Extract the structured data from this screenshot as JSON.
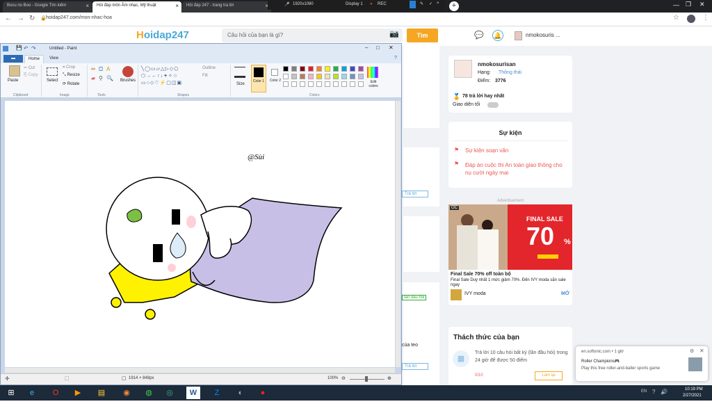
{
  "browser": {
    "tabs": [
      {
        "label": "Bocu no Boo - Google Tìm kiếm",
        "active": false
      },
      {
        "label": "Hỏi đáp môn Âm nhạc, Mỹ thuật",
        "active": true
      },
      {
        "label": "Hỏi đáp 247 - trang tra lời",
        "active": false
      }
    ],
    "recorder": {
      "resolution": "1920x1080",
      "display": "Display 1",
      "rec": "REC"
    },
    "url": "hoidap247.com/mon-nhac-hoa"
  },
  "site": {
    "logo": {
      "first": "H",
      "rest": "oidap247"
    },
    "search_placeholder": "Câu hỏi của bạn là gì?",
    "find_label": "Tìm",
    "username": "nmokosuris ...",
    "profile": {
      "name": "nmokosurisan",
      "rank_label": "Hạng:",
      "rank_value": "Thông thái",
      "points_label": "Điểm:",
      "points_value": "3776",
      "best_answers": "78 trả lời hay nhất",
      "dark_mode_label": "Giao diện tối"
    },
    "events": {
      "title": "Sự kiện",
      "items": [
        "Sự kiện soạn văn",
        "Đáp án cuộc thi An toàn giao thông cho nụ cười ngày mai"
      ]
    },
    "ad": {
      "advertisement_label": "Advertisement",
      "headline": "FINAL SALE",
      "percent": "70",
      "title": "Final Sale 70% off toàn bộ",
      "desc": "Final Sale Duy nhất 1 mức giảm 70%. Đến IVY moda săn sale ngay",
      "brand": "IVY moda",
      "open": "MỞ"
    },
    "middle": {
      "answer_button": "Trả lời",
      "tag1": "lần đầu hỏi",
      "fragment": "của teo",
      "answer_button2": "Trả lời"
    },
    "challenge": {
      "title": "Thách thức của bạn",
      "task": "Trả lời 10 câu hỏi bất kỳ (lần đầu hỏi) trong 24 giờ để được 50 điểm",
      "progress": "0/10",
      "action": "Làm lại"
    },
    "notification": {
      "source": "en.softonic.com • 1 giờ",
      "title": "Roller Champions🎮",
      "body": "Play this free roller-and-baller sports game"
    }
  },
  "paint": {
    "title": "Untitled - Paint",
    "tabs": {
      "file": "▬",
      "home": "Home",
      "view": "View"
    },
    "clipboard": {
      "paste": "Paste",
      "cut": "Cut",
      "copy": "Copy",
      "group": "Clipboard"
    },
    "image": {
      "select": "Select",
      "crop": "Crop",
      "resize": "Resize",
      "rotate": "Rotate",
      "group": "Image"
    },
    "tools_group": "Tools",
    "brushes": "Brushes",
    "shapes": {
      "outline": "Outline",
      "fill": "Fill",
      "group": "Shapes"
    },
    "size": "Size",
    "color1": "Color 1",
    "color2": "Color 2",
    "colors_group": "Colors",
    "edit_colors": "Edit colors",
    "palette": [
      "#000000",
      "#7f7f7f",
      "#880015",
      "#ed1c24",
      "#ff7f27",
      "#fff200",
      "#22b14c",
      "#00a2e8",
      "#3f48cc",
      "#a349a4",
      "#ffffff",
      "#c3c3c3",
      "#b97a57",
      "#ffaec9",
      "#ffc90e",
      "#efe4b0",
      "#b5e61d",
      "#99d9ea",
      "#7092be",
      "#c8bfe7"
    ],
    "signature": "@Sùi",
    "canvas_size": "1914 × 848px",
    "zoom": "100%"
  },
  "taskbar": {
    "icons": [
      "start-icon",
      "ie-icon",
      "opera-icon",
      "media-icon",
      "explorer-icon",
      "firefox-icon",
      "chrome-alt-icon",
      "chrome-icon",
      "word-icon",
      "zalo-icon",
      "app-icon",
      "rec-icon"
    ],
    "clock": "10:19 PM",
    "date": "2/27/2021",
    "lang": "EN"
  }
}
